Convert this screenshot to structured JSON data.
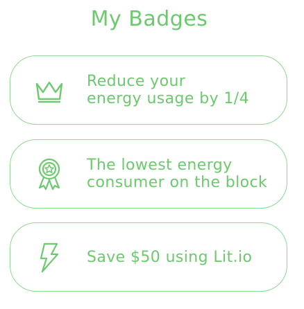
{
  "page": {
    "title": "My Badges"
  },
  "badges": [
    {
      "icon": "crown-icon",
      "lines": [
        "Reduce your",
        "energy usage by 1/4"
      ]
    },
    {
      "icon": "award-ribbon-icon",
      "lines": [
        "The lowest energy",
        "consumer on the block"
      ]
    },
    {
      "icon": "lightning-bolt-icon",
      "lines": [
        "Save $50 using Lit.io"
      ]
    }
  ],
  "colors": {
    "accent": "#6cc96d",
    "border": "#8fd68f",
    "background": "#ffffff"
  }
}
